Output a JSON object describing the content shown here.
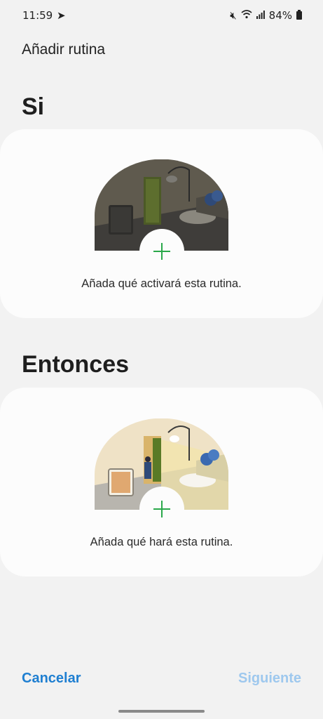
{
  "status_bar": {
    "time": "11:59",
    "battery": "84%",
    "icons": [
      "telegram-icon",
      "mute-icon",
      "wifi-icon",
      "signal-icon",
      "battery-icon"
    ]
  },
  "header": {
    "title": "Añadir rutina"
  },
  "if_section": {
    "title": "Si",
    "hint": "Añada qué activará esta rutina."
  },
  "then_section": {
    "title": "Entonces",
    "hint": "Añada qué hará esta rutina."
  },
  "footer": {
    "cancel_label": "Cancelar",
    "next_label": "Siguiente"
  },
  "colors": {
    "background": "#f2f2f2",
    "card": "#fcfcfc",
    "accent_green": "#2aa84a",
    "cancel_blue": "#1f7fd1",
    "next_disabled_blue": "#9ec8ee"
  }
}
